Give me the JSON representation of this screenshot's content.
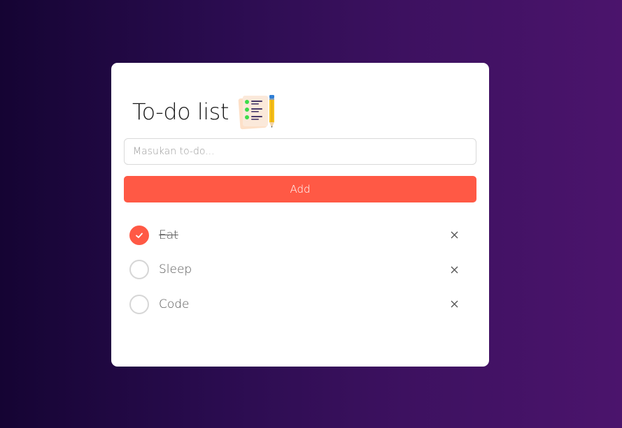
{
  "app": {
    "title": "To-do list",
    "title_icon": "checklist-pencil-icon"
  },
  "input": {
    "placeholder": "Masukan to-do...",
    "value": ""
  },
  "add_button": {
    "label": "Add"
  },
  "todos": [
    {
      "label": "Eat",
      "done": true
    },
    {
      "label": "Sleep",
      "done": false
    },
    {
      "label": "Code",
      "done": false
    }
  ],
  "colors": {
    "accent": "#ff5945",
    "card": "#ffffff",
    "background_start": "#150433",
    "background_end": "#4b146c"
  },
  "icons": {
    "check": "checkmark-icon",
    "remove": "close-icon"
  }
}
